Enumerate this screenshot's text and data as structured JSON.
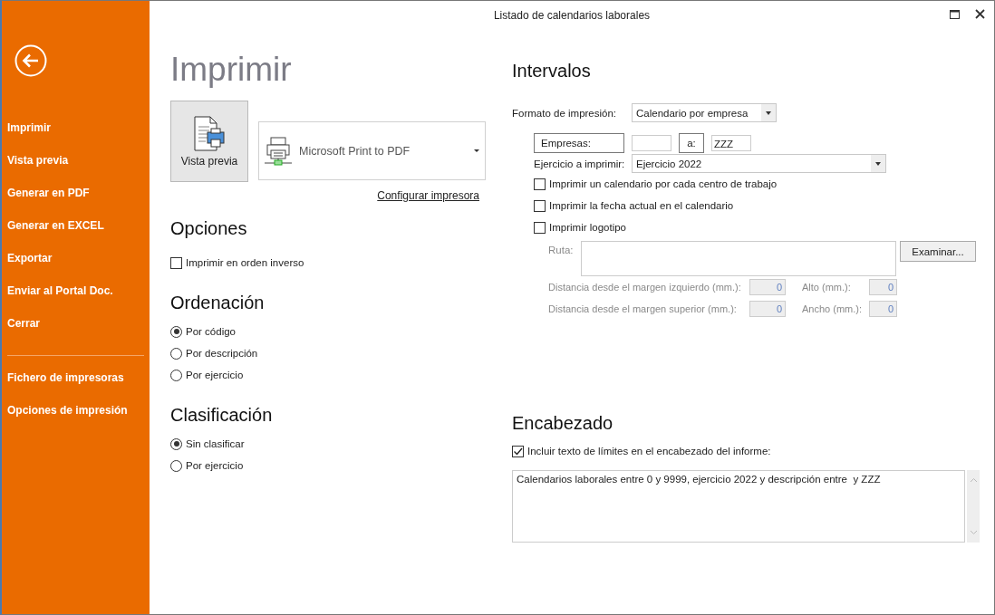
{
  "window": {
    "title": "Listado de calendarios laborales"
  },
  "sidebar": {
    "main_items": [
      {
        "label": "Imprimir"
      },
      {
        "label": "Vista previa"
      },
      {
        "label": "Generar en PDF"
      },
      {
        "label": "Generar en EXCEL"
      },
      {
        "label": "Exportar"
      },
      {
        "label": "Enviar al Portal Doc."
      },
      {
        "label": "Cerrar"
      }
    ],
    "extra_items": [
      {
        "label": "Fichero de impresoras"
      },
      {
        "label": "Opciones de impresión"
      }
    ]
  },
  "page_title": "Imprimir",
  "preview_button": {
    "label": "Vista previa"
  },
  "printer": {
    "value": "Microsoft Print to PDF"
  },
  "configure_link": "Configurar impresora",
  "opciones": {
    "title": "Opciones",
    "options": [
      {
        "label": "Imprimir en orden inverso",
        "checked": false
      }
    ]
  },
  "ordenacion": {
    "title": "Ordenación",
    "options": [
      {
        "label": "Por código",
        "selected": true
      },
      {
        "label": "Por descripción",
        "selected": false
      },
      {
        "label": "Por ejercicio",
        "selected": false
      }
    ]
  },
  "clasificacion": {
    "title": "Clasificación",
    "options": [
      {
        "label": "Sin clasificar",
        "selected": true
      },
      {
        "label": "Por ejercicio",
        "selected": false
      }
    ]
  },
  "intervalos": {
    "title": "Intervalos",
    "format": {
      "label": "Formato de impresión:",
      "value": "Calendario por empresa"
    },
    "empresas": {
      "label": "Empresas:",
      "to_label": "a:",
      "to": "ZZZ"
    },
    "ejercicio": {
      "label": "Ejercicio a imprimir:",
      "value": "Ejercicio 2022"
    },
    "checks": [
      {
        "label": "Imprimir un calendario por cada centro de trabajo",
        "checked": false
      },
      {
        "label": "Imprimir la fecha actual en el calendario",
        "checked": false
      },
      {
        "label": "Imprimir logotipo",
        "checked": false
      }
    ],
    "logo": {
      "disabled": true,
      "ruta_label": "Ruta:",
      "browse": "Examinar...",
      "fields": [
        {
          "label": "Distancia desde el margen izquierdo (mm.):",
          "value": "0"
        },
        {
          "label": "Alto (mm.):",
          "value": "0"
        },
        {
          "label": "Distancia desde el margen superior (mm.):",
          "value": "0"
        },
        {
          "label": "Ancho (mm.):",
          "value": "0"
        }
      ]
    }
  },
  "encabezado": {
    "title": "Encabezado",
    "include": {
      "label": "Incluir texto de límites en el encabezado del informe:",
      "checked": true
    },
    "text": "Calendarios laborales entre 0 y 9999, ejercicio 2022 y descripción entre  y ZZZ"
  }
}
